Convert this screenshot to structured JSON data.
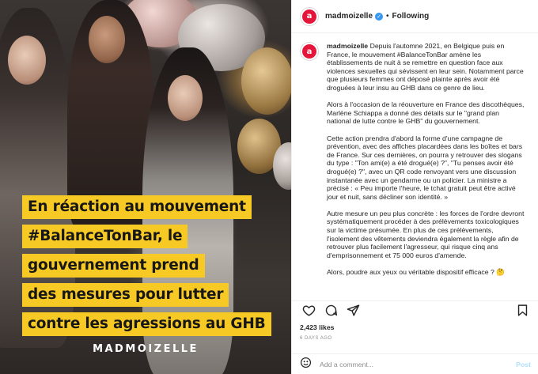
{
  "media": {
    "overlay_lines": [
      "En réaction au mouvement",
      "#BalanceTonBar, le",
      "gouvernement prend",
      "des mesures pour lutter",
      "contre les agressions au GHB"
    ],
    "brand": "MADMOIZELLE",
    "highlight_color": "#f7c924"
  },
  "header": {
    "username": "madmoizelle",
    "separator": "•",
    "follow_status": "Following",
    "avatar_letter": "a",
    "avatar_color": "#e4163a",
    "verified_icon": "verified-check-icon"
  },
  "caption": {
    "username": "madmoizelle",
    "paragraphs": [
      "Depuis l'automne 2021, en Belgique puis en France, le mouvement #BalanceTonBar amène les établissements de nuit à se remettre en question face aux violences sexuelles qui sévissent en leur sein. Notamment parce que plusieurs femmes ont déposé plainte après avoir été droguées à leur insu au GHB dans ce genre de lieu.",
      "Alors à l'occasion de la réouverture en France des discothèques, Marlène Schiappa a donné des détails sur le \"grand plan national de lutte contre le GHB\" du gouvernement.",
      "Cette action prendra d'abord la forme d'une campagne de prévention, avec des affiches placardées dans les boîtes et bars de France. Sur ces dernières, on pourra y retrouver des slogans du type : \"Ton ami(e) a été drogué(e) ?\", \"Tu penses avoir été drogué(e) ?\", avec un QR code renvoyant vers une discussion instantanée avec un gendarme ou un policier. La ministre a précisé : « Peu importe l'heure, le tchat gratuit peut être activé jour et nuit, sans décliner son identité. »",
      "Autre mesure un peu plus concrète : les forces de l'ordre devront systématiquement procéder à des prélèvements toxicologiques sur la victime présumée. En plus de ces prélèvements, l'isolement des vêtements deviendra également la règle afin de retrouver plus facilement l'agresseur, qui risque cinq ans d'emprisonnement et 75 000 euros d'amende.",
      "Alors, poudre aux yeux ou véritable dispositif efficace ? 🤔"
    ]
  },
  "actions": {
    "like_icon": "heart-icon",
    "comment_icon": "comment-icon",
    "share_icon": "share-icon",
    "save_icon": "bookmark-icon"
  },
  "stats": {
    "likes": "2,423 likes",
    "posted": "6 DAYS AGO"
  },
  "comment": {
    "emoji_icon": "smiley-icon",
    "placeholder": "Add a comment...",
    "post_label": "Post"
  }
}
